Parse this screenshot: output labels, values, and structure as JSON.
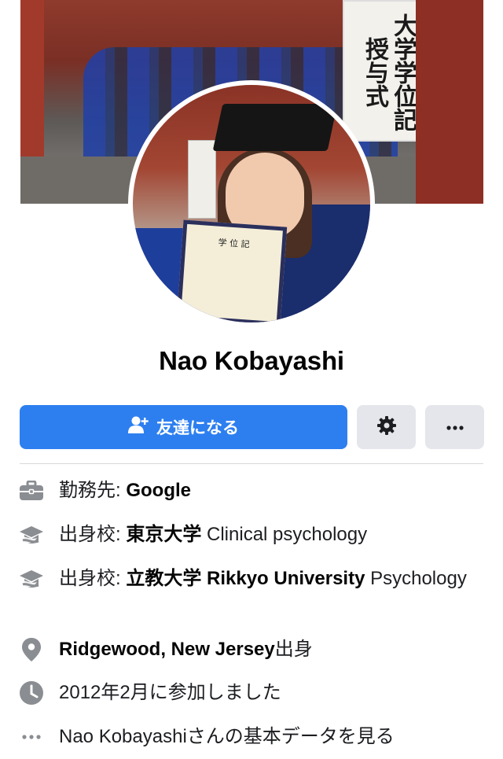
{
  "profile": {
    "name": "Nao Kobayashi",
    "cover_sign_text": "大学学位記授与式",
    "diploma_text": "学 位 記"
  },
  "actions": {
    "add_friend_label": "友達になる",
    "settings_icon": "gear-icon",
    "more_icon": "more-dots-icon"
  },
  "intro": [
    {
      "icon": "briefcase-icon",
      "prefix": "勤務先: ",
      "bold": "Google",
      "suffix": ""
    },
    {
      "icon": "graduation-cap-icon",
      "prefix": "出身校: ",
      "bold": "東京大学",
      "suffix": " Clinical psychology"
    },
    {
      "icon": "graduation-cap-icon",
      "prefix": "出身校: ",
      "bold": "立教大学 Rikkyo University",
      "suffix": " Psychology"
    },
    {
      "icon": "location-pin-icon",
      "prefix": "",
      "bold": "Ridgewood, New Jersey",
      "suffix": "出身"
    },
    {
      "icon": "clock-icon",
      "prefix": "",
      "bold": "",
      "suffix": "2012年2月に参加しました"
    },
    {
      "icon": "more-dots-icon",
      "prefix": "",
      "bold": "",
      "suffix": "Nao Kobayashiさんの基本データを見る"
    }
  ],
  "colors": {
    "primary": "#2d7ff0",
    "secondary_button": "#e4e6eb",
    "icon_gray": "#8a8d91"
  }
}
